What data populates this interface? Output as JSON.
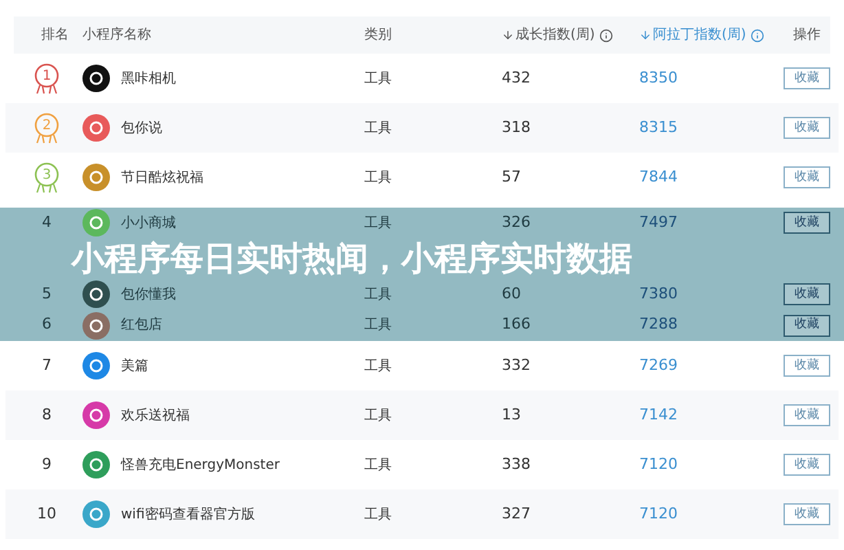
{
  "table": {
    "columns": [
      {
        "label": "排名",
        "kind": "plain"
      },
      {
        "label": "小程序名称",
        "kind": "plain"
      },
      {
        "label": "类别",
        "kind": "plain"
      },
      {
        "label": "成长指数(周)",
        "kind": "sort",
        "selected": false
      },
      {
        "label": "阿拉丁指数(周)",
        "kind": "sort",
        "selected": true
      },
      {
        "label": "操作",
        "kind": "plain"
      }
    ],
    "rows": [
      {
        "rank": "1",
        "kind": "medal",
        "name": "黑咔相机",
        "color": "#111111",
        "category": "工具",
        "growth": "432",
        "aladdin": "8350",
        "action": "收藏"
      },
      {
        "rank": "2",
        "kind": "medal",
        "name": "包你说",
        "color": "#e85a5a",
        "category": "工具",
        "growth": "318",
        "aladdin": "8315",
        "action": "收藏"
      },
      {
        "rank": "3",
        "kind": "medal",
        "name": "节日酷炫祝福",
        "color": "#c8902a",
        "category": "工具",
        "growth": "57",
        "aladdin": "7844",
        "action": "收藏"
      },
      {
        "rank": "4",
        "kind": "plain",
        "name": "小小商城",
        "color": "#5cb85c",
        "category": "工具",
        "growth": "326",
        "aladdin": "7497",
        "action": "收藏"
      },
      {
        "rank": "5",
        "kind": "plain",
        "name": "包你懂我",
        "color": "#2f4f4f",
        "category": "工具",
        "growth": "60",
        "aladdin": "7380",
        "action": "收藏"
      },
      {
        "rank": "6",
        "kind": "plain",
        "name": "红包店",
        "color": "#8a6e64",
        "category": "工具",
        "growth": "166",
        "aladdin": "7288",
        "action": "收藏"
      },
      {
        "rank": "7",
        "kind": "plain",
        "name": "美篇",
        "color": "#1e88e5",
        "category": "工具",
        "growth": "332",
        "aladdin": "7269",
        "action": "收藏"
      },
      {
        "rank": "8",
        "kind": "plain",
        "name": "欢乐送祝福",
        "color": "#d63aa8",
        "category": "工具",
        "growth": "13",
        "aladdin": "7142",
        "action": "收藏"
      },
      {
        "rank": "9",
        "kind": "plain",
        "name": "怪兽充电EnergyMonster",
        "color": "#2e9e5b",
        "category": "工具",
        "growth": "338",
        "aladdin": "7120",
        "action": "收藏"
      },
      {
        "rank": "10",
        "kind": "plain",
        "name": "wifi密码查看器官方版",
        "color": "#3aa7c9",
        "category": "工具",
        "growth": "327",
        "aladdin": "7120",
        "action": "收藏"
      }
    ]
  },
  "banner": {
    "title": "小程序每日实时热闻，小程序实时数据"
  }
}
